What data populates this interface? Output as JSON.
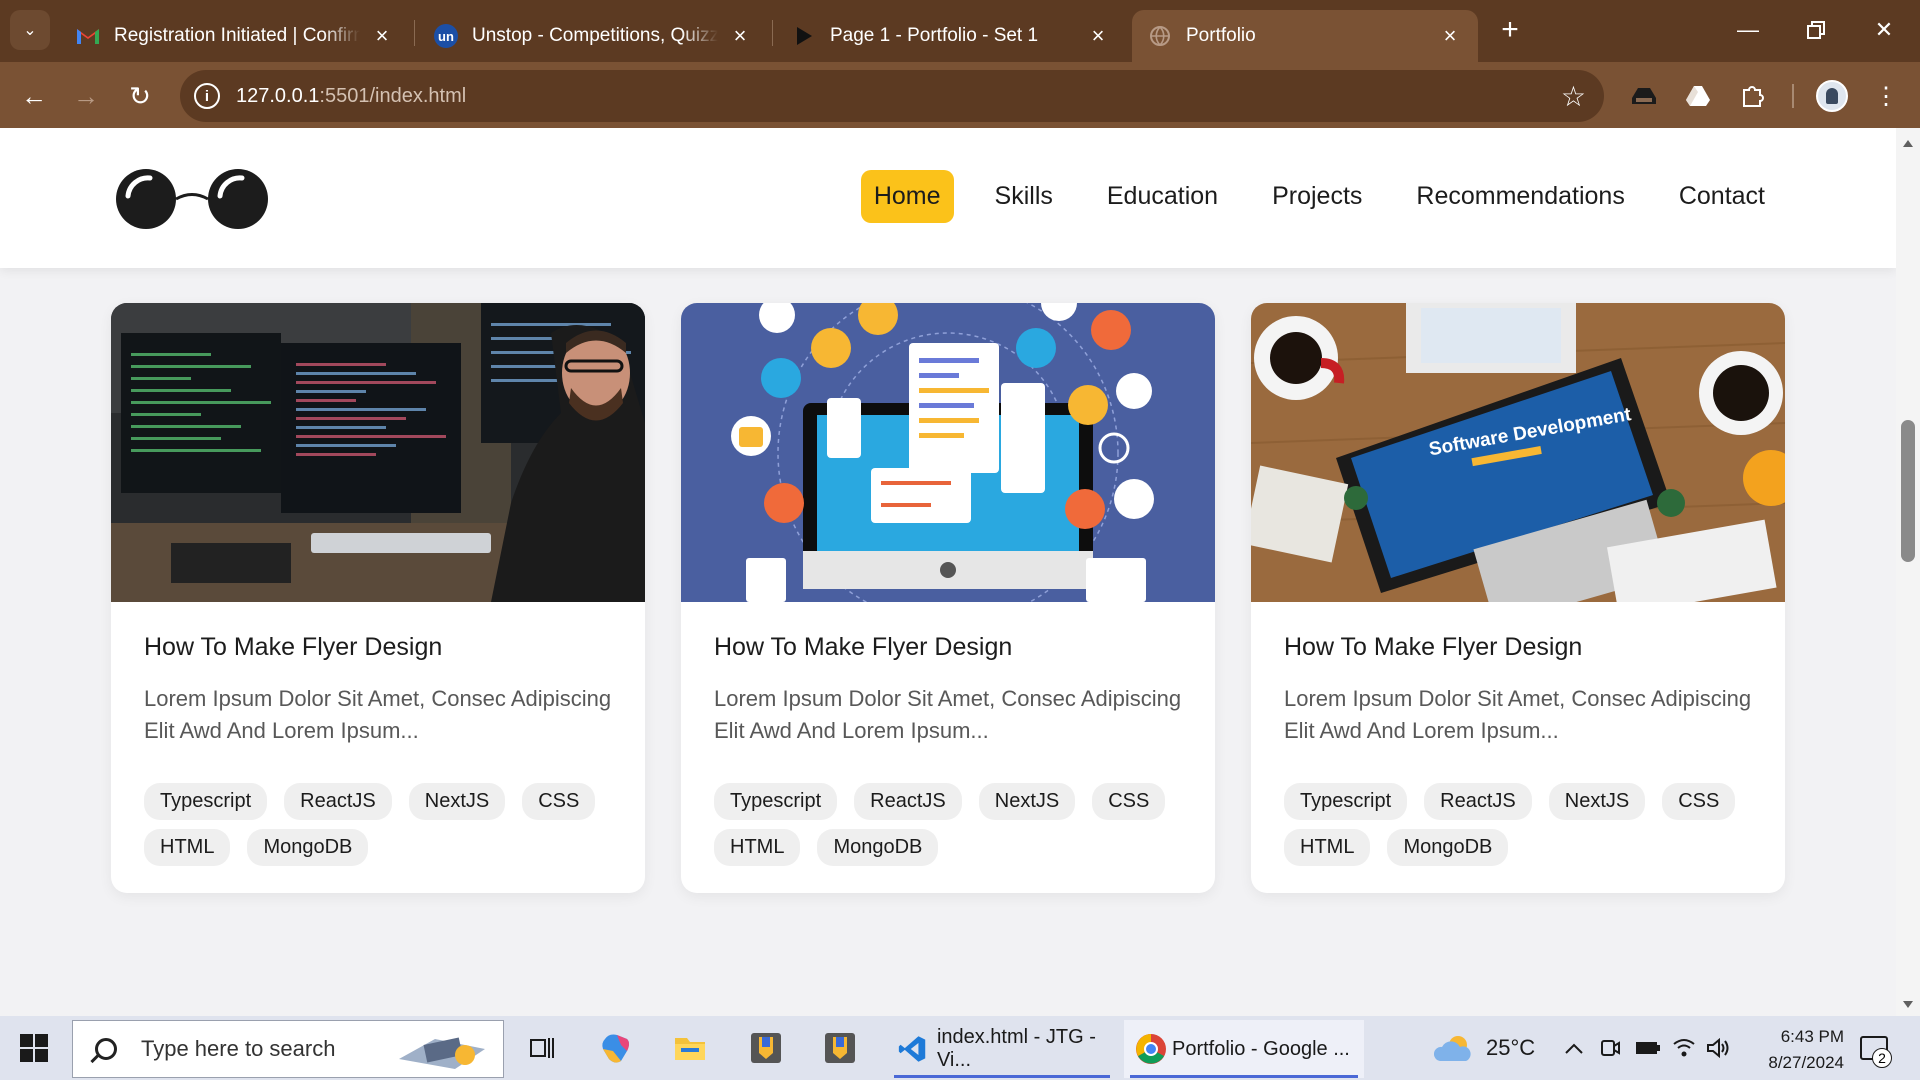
{
  "browser": {
    "tabs": [
      {
        "title": "Registration Initiated | Confirmation",
        "favicon": "gmail-icon"
      },
      {
        "title": "Unstop - Competitions, Quizzes",
        "favicon": "un"
      },
      {
        "title": "Page 1 - Portfolio - Set 1",
        "favicon": "play-icon"
      },
      {
        "title": "Portfolio",
        "favicon": "globe-icon",
        "active": true
      }
    ],
    "url_host": "127.0.0.1",
    "url_rest": ":5501/index.html"
  },
  "site": {
    "nav": [
      "Home",
      "Skills",
      "Education",
      "Projects",
      "Recommendations",
      "Contact"
    ],
    "active_nav": "Home",
    "accent": "#fbc21a"
  },
  "projects": [
    {
      "image": "developer-at-monitors",
      "title": "How To Make Flyer Design",
      "description": "Lorem Ipsum Dolor Sit Amet, Consec Adipiscing Elit Awd And Lorem Ipsum...",
      "tags": [
        "Typescript",
        "ReactJS",
        "NextJS",
        "CSS",
        "HTML",
        "MongoDB"
      ]
    },
    {
      "image": "computer-network-illustration",
      "title": "How To Make Flyer Design",
      "description": "Lorem Ipsum Dolor Sit Amet, Consec Adipiscing Elit Awd And Lorem Ipsum...",
      "tags": [
        "Typescript",
        "ReactJS",
        "NextJS",
        "CSS",
        "HTML",
        "MongoDB"
      ]
    },
    {
      "image": "software-development-desk",
      "image_text": "Software Development",
      "title": "How To Make Flyer Design",
      "description": "Lorem Ipsum Dolor Sit Amet, Consec Adipiscing Elit Awd And Lorem Ipsum...",
      "tags": [
        "Typescript",
        "ReactJS",
        "NextJS",
        "CSS",
        "HTML",
        "MongoDB"
      ]
    }
  ],
  "taskbar": {
    "search_placeholder": "Type here to search",
    "apps": [
      {
        "label": "index.html - JTG - Vi...",
        "icon": "vscode-icon"
      },
      {
        "label": "Portfolio - Google ...",
        "icon": "chrome-icon"
      }
    ],
    "weather": "25°C",
    "time": "6:43 PM",
    "date": "8/27/2024",
    "notifications": "2"
  }
}
